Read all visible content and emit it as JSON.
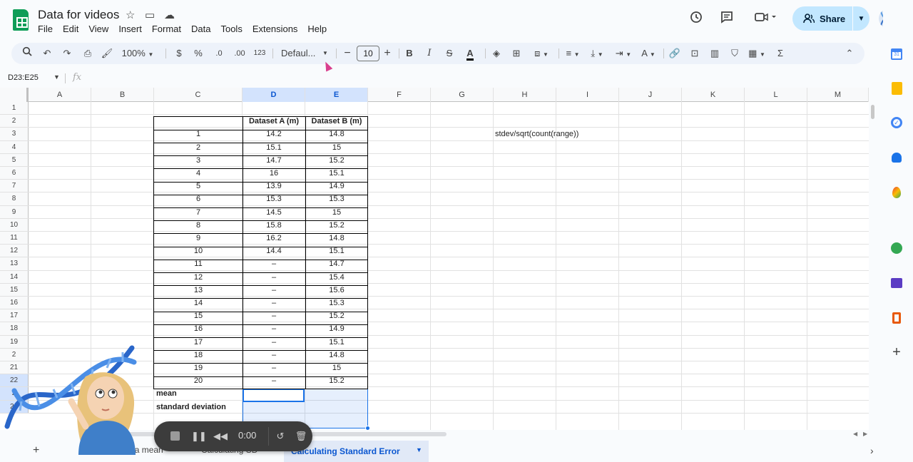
{
  "app": {
    "doc_title": "Data for videos",
    "menus": [
      "File",
      "Edit",
      "View",
      "Insert",
      "Format",
      "Data",
      "Tools",
      "Extensions",
      "Help"
    ],
    "share_label": "Share"
  },
  "toolbar": {
    "zoom": "100%",
    "currency": "$",
    "percent": "%",
    "dec_decrease": ".0",
    "dec_increase": ".00",
    "number_format": "123",
    "font": "Defaul...",
    "font_size": "10"
  },
  "formula_bar": {
    "name_box": "D23:E25",
    "fx": "fx",
    "formula": ""
  },
  "grid": {
    "columns": [
      "A",
      "B",
      "C",
      "D",
      "E",
      "F",
      "G",
      "H",
      "I",
      "J",
      "K",
      "L",
      "M"
    ],
    "row_numbers": [
      "1",
      "2",
      "3",
      "4",
      "5",
      "6",
      "7",
      "8",
      "9",
      "10",
      "11",
      "12",
      "13",
      "14",
      "15",
      "16",
      "17",
      "18",
      "19",
      "2",
      "21",
      "22",
      "2",
      "24"
    ],
    "header_row": {
      "c": "",
      "d": "Dataset A (m)",
      "e": "Dataset B (m)"
    },
    "data_rows": [
      {
        "c": "1",
        "d": "14.2",
        "e": "14.8"
      },
      {
        "c": "2",
        "d": "15.1",
        "e": "15"
      },
      {
        "c": "3",
        "d": "14.7",
        "e": "15.2"
      },
      {
        "c": "4",
        "d": "16",
        "e": "15.1"
      },
      {
        "c": "5",
        "d": "13.9",
        "e": "14.9"
      },
      {
        "c": "6",
        "d": "15.3",
        "e": "15.3"
      },
      {
        "c": "7",
        "d": "14.5",
        "e": "15"
      },
      {
        "c": "8",
        "d": "15.8",
        "e": "15.2"
      },
      {
        "c": "9",
        "d": "16.2",
        "e": "14.8"
      },
      {
        "c": "10",
        "d": "14.4",
        "e": "15.1"
      },
      {
        "c": "11",
        "d": "–",
        "e": "14.7"
      },
      {
        "c": "12",
        "d": "–",
        "e": "15.4"
      },
      {
        "c": "13",
        "d": "–",
        "e": "15.6"
      },
      {
        "c": "14",
        "d": "–",
        "e": "15.3"
      },
      {
        "c": "15",
        "d": "–",
        "e": "15.2"
      },
      {
        "c": "16",
        "d": "–",
        "e": "14.9"
      },
      {
        "c": "17",
        "d": "–",
        "e": "15.1"
      },
      {
        "c": "18",
        "d": "–",
        "e": "14.8"
      },
      {
        "c": "19",
        "d": "–",
        "e": "15"
      },
      {
        "c": "20",
        "d": "–",
        "e": "15.2"
      }
    ],
    "stat_labels": [
      "mean",
      "standard deviation",
      "st..."
    ],
    "note_h3": "stdev/sqrt(count(range))"
  },
  "sheets": {
    "tab1": "Calculating a mean",
    "tab2": "Calculating SD",
    "tab3_active": "Calculating Standard Error"
  },
  "recorder": {
    "time": "0:00"
  },
  "icons": {
    "header": [
      "star-icon",
      "move-icon",
      "cloud-icon",
      "history-icon",
      "comment-icon",
      "video-icon"
    ],
    "side": [
      "calendar-icon",
      "keep-icon",
      "tasks-icon",
      "contacts-icon",
      "maps-icon",
      "addon-icon",
      "forms-icon",
      "office-icon",
      "plus-icon"
    ]
  },
  "colors": {
    "accent": "#0b57d0",
    "share_bg": "#c2e7ff",
    "selection": "#1a73e8",
    "sheets_green": "#0f9d58"
  }
}
